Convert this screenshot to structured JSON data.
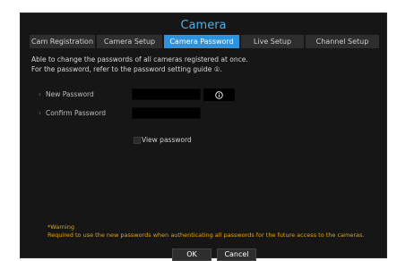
{
  "window": {
    "title": "Camera"
  },
  "tabs": [
    {
      "label": "Cam Registration",
      "active": false
    },
    {
      "label": "Camera Setup",
      "active": false
    },
    {
      "label": "Camera Password",
      "active": true
    },
    {
      "label": "Live Setup",
      "active": false
    },
    {
      "label": "Channel Setup",
      "active": false
    }
  ],
  "description": {
    "line1": "Able to change the passwords of all cameras registered at once.",
    "line2": "For the password, refer to the password setting guide ①."
  },
  "form": {
    "new_password_label": "New Password",
    "new_password_value": "",
    "confirm_password_label": "Confirm Password",
    "confirm_password_value": "",
    "info_icon": "info-icon",
    "view_password_label": "View password",
    "view_password_checked": false
  },
  "warning": {
    "title": "*Warning",
    "text": "Required to use the new passwords when authenticating all passwords for the future access to the cameras."
  },
  "buttons": {
    "ok": "OK",
    "cancel": "Cancel"
  },
  "colors": {
    "title": "#4fb0e6",
    "active_tab": "#2e93de",
    "warning": "#e5a30d",
    "background": "#161616"
  }
}
